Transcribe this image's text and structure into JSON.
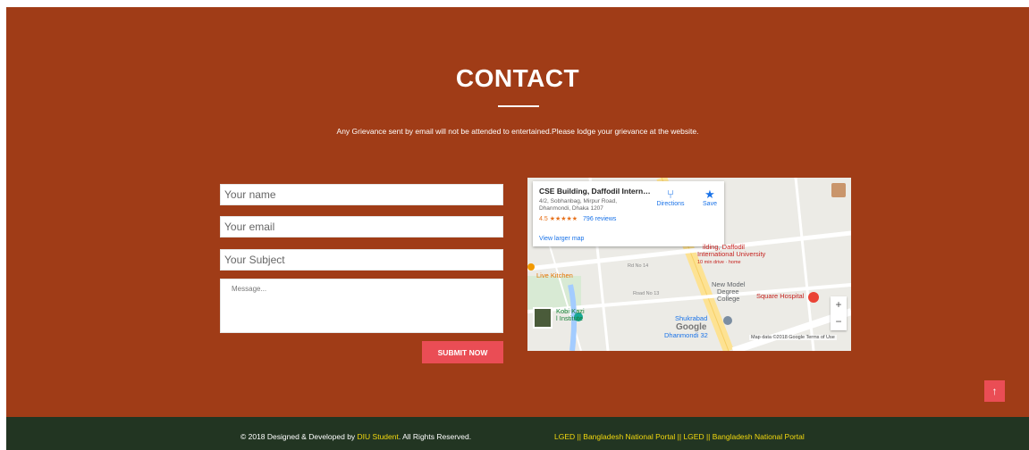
{
  "contact": {
    "title": "CONTACT",
    "notice": "Any Grievance sent by email will not be attended to entertained.Please lodge your grievance at the website."
  },
  "form": {
    "name_placeholder": "Your name",
    "email_placeholder": "Your email",
    "subject_placeholder": "Your Subject",
    "message_placeholder": "Message...",
    "submit_label": "SUBMIT NOW"
  },
  "map": {
    "place_name": "CSE Building, Daffodil Internat...",
    "address_line1": "4/2, Sobhanbag, Mirpur Road,",
    "address_line2": "Dhanmondi, Dhaka 1207",
    "rating_value": "4.5",
    "rating_stars": "★★★★★",
    "reviews": "796 reviews",
    "directions_label": "Directions",
    "save_label": "Save",
    "larger_map": "View larger map",
    "label_university_1": "ilding, Daffodil",
    "label_university_2": "International University",
    "label_drive": "10 min drive · home",
    "label_live_kitchen": "Live Kitchen",
    "label_new_model": "New Model",
    "label_degree": "Degree",
    "label_college": "College",
    "label_square": "Square Hospital",
    "label_kobi_1": "Kobi Kazi",
    "label_kobi_2": "l Institute",
    "label_shukrabad": "Shukrabad",
    "label_dhanmondi": "Dhanmondi 32",
    "label_road13": "Road No 13",
    "label_road14": "Rd No 14",
    "google_logo": "Google",
    "attribution": "Map data ©2018 Google   Terms of Use",
    "zoom_in": "+",
    "zoom_out": "−"
  },
  "back_to_top": "↑",
  "footer": {
    "copy_prefix": "© 2018 Designed & Developed by ",
    "copy_highlight": "DIU Student",
    "copy_suffix": ". All Rights Reserved.",
    "links": "LGED || Bangladesh National Portal || LGED || Bangladesh National Portal"
  },
  "colors": {
    "section_bg": "#a03c17",
    "footer_bg": "#223522",
    "accent": "#ea4d55",
    "link_yellow": "#f3d80e"
  }
}
